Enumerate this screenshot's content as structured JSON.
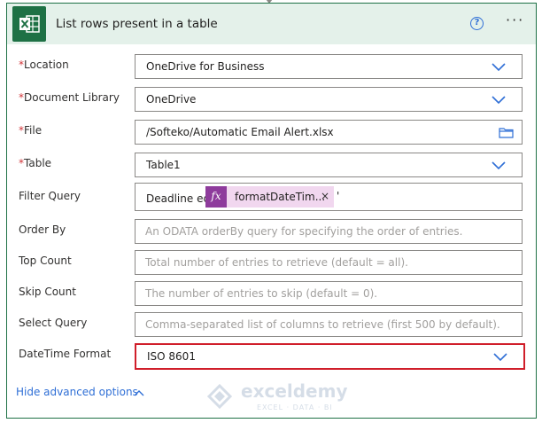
{
  "header": {
    "title": "List rows present in a table",
    "help_symbol": "?",
    "more_symbol": "···",
    "app_icon": "excel-icon"
  },
  "fields": {
    "location": {
      "label": "Location",
      "required": "*",
      "value": "OneDrive for Business"
    },
    "document_library": {
      "label": "Document Library",
      "required": "*",
      "value": "OneDrive"
    },
    "file": {
      "label": "File",
      "required": "*",
      "value": "/Softeko/Automatic Email Alert.xlsx"
    },
    "table": {
      "label": "Table",
      "required": "*",
      "value": "Table1"
    },
    "filter_query": {
      "label": "Filter Query",
      "prefix": "Deadline eq'",
      "token_symbol": "fx",
      "token_label": "formatDateTim...",
      "token_close": "×",
      "suffix": "'"
    },
    "order_by": {
      "label": "Order By",
      "placeholder": "An ODATA orderBy query for specifying the order of entries."
    },
    "top_count": {
      "label": "Top Count",
      "placeholder": "Total number of entries to retrieve (default = all)."
    },
    "skip_count": {
      "label": "Skip Count",
      "placeholder": "The number of entries to skip (default = 0)."
    },
    "select_query": {
      "label": "Select Query",
      "placeholder": "Comma-separated list of columns to retrieve (first 500 by default)."
    },
    "datetime_format": {
      "label": "DateTime Format",
      "value": "ISO 8601"
    }
  },
  "footer": {
    "hide_advanced": "Hide advanced options"
  },
  "watermark": {
    "name": "exceldemy",
    "tagline": "EXCEL · DATA · BI"
  },
  "colors": {
    "excel_green": "#1e7145",
    "header_bg": "#e4f1ea",
    "accent_blue": "#2f6fd6",
    "required_red": "#d13438",
    "highlight_red": "#d01e2a",
    "token_purple": "#8e3b9c"
  }
}
